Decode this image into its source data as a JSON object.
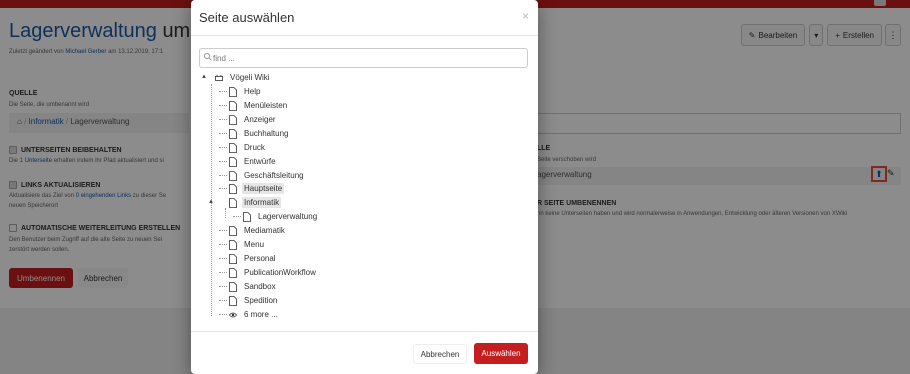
{
  "background": {
    "page_title_main": "Lagerverwaltung",
    "page_title_rest": "umb",
    "meta_prefix": "Zuletzt geändert von",
    "meta_author": "Michael Gerber",
    "meta_suffix": "am 13.12.2019, 17:1",
    "toolbar": {
      "edit_label": "Bearbeiten",
      "create_label": "Erstellen"
    },
    "source": {
      "title": "QUELLE",
      "text": "Die Seite, die umbenannt wird",
      "breadcrumb_1": "Informatik",
      "breadcrumb_2": "Lagerverwaltung"
    },
    "children": {
      "title": "UNTERSEITEN BEIBEHALTEN",
      "text_prefix": "Die 1",
      "text_link": "Unterseite",
      "text_suffix": "erhalten indem ihr Pfad aktualisiert und si"
    },
    "links": {
      "title": "LINKS AKTUALISIEREN",
      "text_prefix": "Aktualisiere das Ziel von",
      "text_link": "0 eingehenden Links",
      "text_suffix": "zu dieser Se",
      "text_line2": "neuen Speicherort"
    },
    "redirect": {
      "title": "AUTOMATISCHE WEITERLEITUNG ERSTELLEN",
      "text_line1": "Den Benutzer beim Zugriff auf die alte Seite zu neuen Sei",
      "text_line2": "zerstört werden sollen."
    },
    "rename_button": "Umbenennen",
    "cancel_button": "Abbrechen",
    "right": {
      "target_title": "LLE",
      "target_text": "Seite verschoben wird",
      "target_value": "agerverwaltung",
      "terminal_title": "R SEITE UMBENENNEN",
      "terminal_text": "nn keine Unterseiten haben und wird normalerweise in Anwendungen, Entwicklung oder älteren Versionen von XWiki"
    }
  },
  "modal": {
    "title": "Seite auswählen",
    "close_glyph": "×",
    "search_placeholder": "find ...",
    "tree": {
      "root": "Vögeli Wiki",
      "items": [
        "Help",
        "Menüleisten",
        "Anzeiger",
        "Buchhaltung",
        "Druck",
        "Entwürfe",
        "Geschäftsleitung",
        "Hauptseite",
        "Informatik",
        "Lagerverwaltung",
        "Mediamatik",
        "Menu",
        "Personal",
        "PublicationWorkflow",
        "Sandbox",
        "Spedition",
        "6 more ..."
      ]
    },
    "cancel_label": "Abbrechen",
    "select_label": "Auswählen"
  },
  "colors": {
    "accent": "#c41e1e",
    "link": "#1a5aa6",
    "highlight_border": "#e74c3c"
  }
}
